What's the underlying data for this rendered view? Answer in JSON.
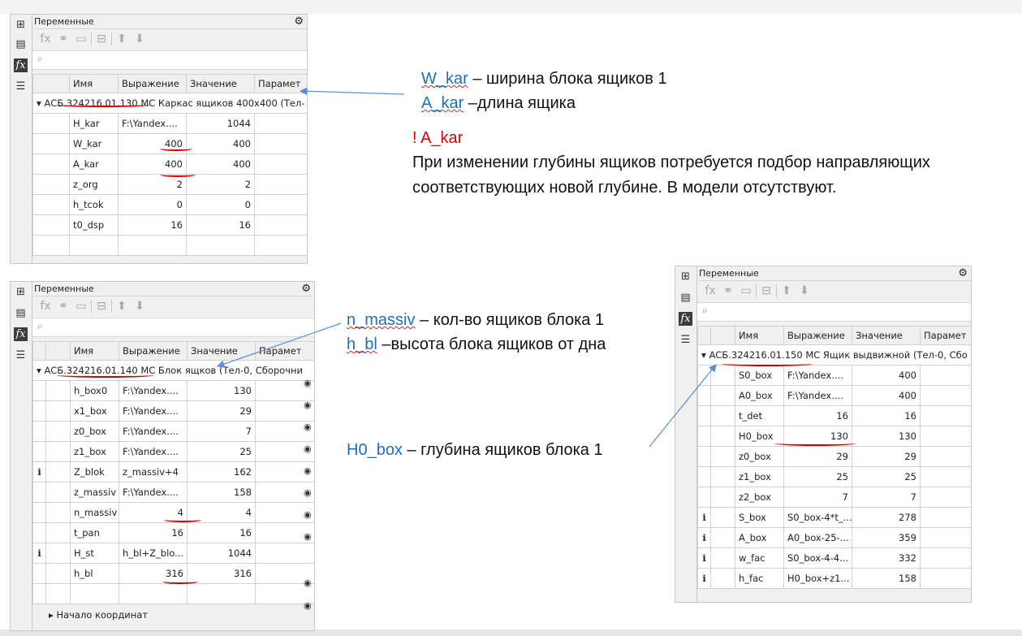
{
  "panel_common": {
    "title": "Переменные",
    "columns": [
      "Имя",
      "Выражение",
      "Значение",
      "Парамет"
    ],
    "search_placeholder": ""
  },
  "panel1": {
    "group": "АСБ.324216.01.130 МС Каркас ящиков 400x400 (Тел-",
    "rows": [
      {
        "name": "H_kar",
        "expr": "F:\\Yandex....",
        "value": "1044"
      },
      {
        "name": "W_kar",
        "expr": "400",
        "value": "400"
      },
      {
        "name": "A_kar",
        "expr": "400",
        "value": "400"
      },
      {
        "name": "z_org",
        "expr": "2",
        "value": "2"
      },
      {
        "name": "h_tcok",
        "expr": "0",
        "value": "0"
      },
      {
        "name": "t0_dsp",
        "expr": "16",
        "value": "16"
      }
    ]
  },
  "panel2": {
    "group": "АСБ.324216.01.140 МС Блок ящков (Тел-0, Сборочни",
    "rows": [
      {
        "info": "",
        "name": "h_box0",
        "expr": "F:\\Yandex....",
        "value": "130"
      },
      {
        "info": "",
        "name": "x1_box",
        "expr": "F:\\Yandex....",
        "value": "29"
      },
      {
        "info": "",
        "name": "z0_box",
        "expr": "F:\\Yandex....",
        "value": "7"
      },
      {
        "info": "",
        "name": "z1_box",
        "expr": "F:\\Yandex....",
        "value": "25"
      },
      {
        "info": "i",
        "name": "Z_blok",
        "expr": "z_massiv+4",
        "value": "162"
      },
      {
        "info": "",
        "name": "z_massiv",
        "expr": "F:\\Yandex....",
        "value": "158"
      },
      {
        "info": "",
        "name": "n_massiv",
        "expr": "4",
        "value": "4"
      },
      {
        "info": "",
        "name": "t_pan",
        "expr": "16",
        "value": "16"
      },
      {
        "info": "i",
        "name": "H_st",
        "expr": "h_bl+Z_blo...",
        "value": "1044"
      },
      {
        "info": "",
        "name": "h_bl",
        "expr": "316",
        "value": "316"
      }
    ],
    "footer": "Начало координат"
  },
  "panel3": {
    "group": "АСБ.324216.01.150 МС Ящик выдвижной (Тел-0, Сбо",
    "rows": [
      {
        "info": "",
        "name": "S0_box",
        "expr": "F:\\Yandex....",
        "value": "400"
      },
      {
        "info": "",
        "name": "A0_box",
        "expr": "F:\\Yandex....",
        "value": "400"
      },
      {
        "info": "",
        "name": "t_det",
        "expr": "16",
        "value": "16"
      },
      {
        "info": "",
        "name": "H0_box",
        "expr": "130",
        "value": "130"
      },
      {
        "info": "",
        "name": "z0_box",
        "expr": "29",
        "value": "29"
      },
      {
        "info": "",
        "name": "z1_box",
        "expr": "25",
        "value": "25"
      },
      {
        "info": "",
        "name": "z2_box",
        "expr": "7",
        "value": "7"
      },
      {
        "info": "i",
        "name": "S_box",
        "expr": "S0_box-4*t_...",
        "value": "278"
      },
      {
        "info": "i",
        "name": "A_box",
        "expr": "A0_box-25-...",
        "value": "359"
      },
      {
        "info": "i",
        "name": "w_fac",
        "expr": "S0_box-4-4...",
        "value": "332"
      },
      {
        "info": "i",
        "name": "h_fac",
        "expr": "H0_box+z1...",
        "value": "158"
      }
    ]
  },
  "notes": {
    "n1_key": "W_kar",
    "n1_text": " – ширина блока ящиков 1",
    "n2_key": "A_kar",
    "n2_text": " –длина ящика",
    "warn": "! A_kar",
    "warn_line1": "При изменении глубины ящиков потребуется подбор направляющих",
    "warn_line2": " соответствующих новой глубине. В модели отсутствуют.",
    "n3_key": "n_massiv",
    "n3_text": " – кол-во ящиков блока 1",
    "n4_key": "h_bl",
    "n4_text": " –высота блока ящиков от дна",
    "n5_key": "H0_box",
    "n5_text": " – глубина ящиков блока 1"
  },
  "colors": {
    "accent_blue": "#1f6fc0",
    "mark_red": "#d00000",
    "warn_red": "#e00000"
  },
  "icons": [
    "tree-icon",
    "properties-icon",
    "fx-icon",
    "list-icon",
    "gear-icon",
    "fx-add-icon",
    "link-icon",
    "table-icon",
    "formula-icon",
    "arrow-up-icon",
    "arrow-down-icon",
    "search-icon",
    "eye-icon",
    "info-icon"
  ]
}
